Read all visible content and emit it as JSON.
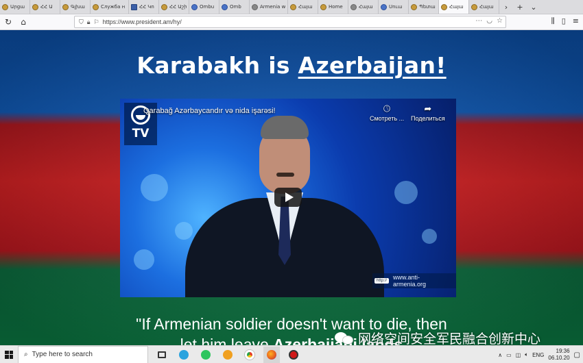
{
  "browser": {
    "tabs": [
      {
        "label": "Արցա",
        "icon": "coat-of-arms-icon",
        "active": false
      },
      {
        "label": "ՀՀ Ա",
        "icon": "coat-of-arms-icon",
        "active": false
      },
      {
        "label": "Գլխա",
        "icon": "coat-of-arms-icon",
        "active": false
      },
      {
        "label": "Служба н",
        "icon": "coat-of-arms-icon",
        "active": false
      },
      {
        "label": "ՀՀ Կո",
        "icon": "square-site-icon",
        "active": false
      },
      {
        "label": "ՀՀ Աշխ",
        "icon": "coat-of-arms-icon",
        "active": false
      },
      {
        "label": "Ombu",
        "icon": "globe-icon",
        "active": false
      },
      {
        "label": "Omb",
        "icon": "globe-icon",
        "active": false
      },
      {
        "label": "Armenia w",
        "icon": "blank-page-icon",
        "active": false
      },
      {
        "label": "Հայա",
        "icon": "coat-of-arms-icon",
        "active": false
      },
      {
        "label": "Home",
        "icon": "coat-of-arms-icon",
        "active": false
      },
      {
        "label": "Հայա",
        "icon": "diamond-icon",
        "active": false
      },
      {
        "label": "Սուա",
        "icon": "globe-icon",
        "active": false
      },
      {
        "label": "Պետա",
        "icon": "coat-of-arms-icon",
        "active": false
      },
      {
        "label": "Հայա",
        "icon": "coat-of-arms-icon",
        "active": true
      },
      {
        "label": "Հայա",
        "icon": "coat-of-arms-icon",
        "active": false
      }
    ],
    "tab_scroll_right": "›",
    "new_tab": "+",
    "tab_list": "⌄",
    "url": "https://www.president.am/hy/"
  },
  "page": {
    "headline_prefix": "Karabakh is ",
    "headline_link": "Azerbaijan!",
    "quote_line1": "\"If Armenian soldier doesn't want to die, then",
    "quote_line2_prefix": "let him leave ",
    "quote_line2_bold": "Azerbaijani lands"
  },
  "video": {
    "title": "Qarabağ Azərbaycandır və nida işarəsi!",
    "logo_text": "TV",
    "watch_later": "Смотреть ...",
    "share": "Поделиться",
    "url_badge": "http://",
    "url_text": "www.anti-armenia.org"
  },
  "watermark": {
    "text": "网络空间安全军民融合创新中心"
  },
  "taskbar": {
    "search_placeholder": "Type here to search",
    "lang": "ENG",
    "time": "19:36",
    "date": "06.10.20"
  }
}
